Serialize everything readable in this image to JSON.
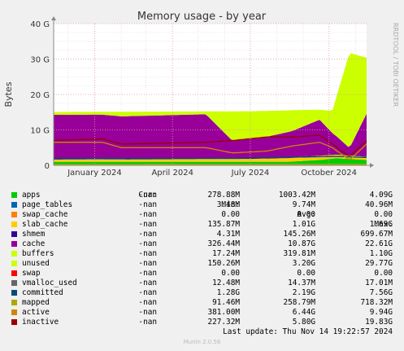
{
  "chart_data": {
    "type": "area",
    "title": "Memory usage - by year",
    "ylabel": "Bytes",
    "side_label": "RRDTOOL / TOBI OETIKER",
    "ylim": [
      0,
      40
    ],
    "y_unit": "G",
    "yticks": [
      0,
      10,
      20,
      30,
      40
    ],
    "ytick_labels": [
      "0",
      "10 G",
      "20 G",
      "30 G",
      "40 G"
    ],
    "xlim": [
      "2023-11-14",
      "2024-11-14"
    ],
    "xticks": [
      "2024-01-01",
      "2024-04-01",
      "2024-07-01",
      "2024-10-01"
    ],
    "xtick_labels": [
      "January 2024",
      "April 2024",
      "July 2024",
      "October 2024"
    ],
    "stacked_series": [
      {
        "name": "apps",
        "color": "#00cc00",
        "x": [
          "2023-11-14",
          "2024-01-15",
          "2024-06-10",
          "2024-08-15",
          "2024-09-20",
          "2024-10-10",
          "2024-11-14"
        ],
        "values": [
          1.0,
          1.0,
          1.0,
          1.0,
          1.5,
          2.0,
          1.5
        ]
      },
      {
        "name": "page_tables",
        "color": "#0066b3",
        "x": [
          "2023-11-14",
          "2024-11-14"
        ],
        "values": [
          0.01,
          0.02
        ]
      },
      {
        "name": "swap_cache",
        "color": "#ff8000",
        "x": [
          "2023-11-14",
          "2024-11-14"
        ],
        "values": [
          0,
          0
        ]
      },
      {
        "name": "slab_cache",
        "color": "#ffcc00",
        "x": [
          "2023-11-14",
          "2024-07-01",
          "2024-09-20",
          "2024-10-10",
          "2024-11-14"
        ],
        "values": [
          0.6,
          0.8,
          1.2,
          1.0,
          0.9
        ]
      },
      {
        "name": "shmem",
        "color": "#330099",
        "x": [
          "2023-11-14",
          "2024-11-14"
        ],
        "values": [
          0.14,
          0.15
        ]
      },
      {
        "name": "cache",
        "color": "#990099",
        "x": [
          "2023-11-14",
          "2024-01-10",
          "2024-02-01",
          "2024-05-10",
          "2024-06-10",
          "2024-07-20",
          "2024-08-20",
          "2024-09-20",
          "2024-10-05",
          "2024-10-25",
          "2024-11-14"
        ],
        "values": [
          12.5,
          12.5,
          12.0,
          12.5,
          5.0,
          6.0,
          7.5,
          10.0,
          6.0,
          2.0,
          12.0
        ]
      },
      {
        "name": "buffers",
        "color": "#ccff00",
        "x": [
          "2023-11-14",
          "2024-11-14"
        ],
        "values": [
          0.3,
          0.3
        ]
      },
      {
        "name": "unused",
        "color": "#ccff00",
        "x": [
          "2023-11-14",
          "2024-01-10",
          "2024-02-01",
          "2024-05-10",
          "2024-06-10",
          "2024-07-20",
          "2024-08-20",
          "2024-09-20",
          "2024-10-05",
          "2024-10-25",
          "2024-11-14"
        ],
        "values": [
          0.5,
          0.5,
          1.0,
          0.5,
          8.0,
          7.0,
          5.5,
          2.5,
          6.0,
          26.5,
          15.5
        ]
      },
      {
        "name": "swap",
        "color": "#ff0000",
        "x": [
          "2023-11-14",
          "2024-11-14"
        ],
        "values": [
          0,
          0
        ]
      }
    ],
    "line_series": [
      {
        "name": "vmalloc_used",
        "color": "#666666",
        "x": [
          "2023-11-14",
          "2024-11-14"
        ],
        "values": [
          0.014,
          0.015
        ]
      },
      {
        "name": "committed",
        "color": "#014d7a",
        "x": [
          "2023-11-14",
          "2024-06-10",
          "2024-10-10",
          "2024-11-14"
        ],
        "values": [
          2.0,
          2.0,
          2.5,
          2.2
        ]
      },
      {
        "name": "mapped",
        "color": "#aaaa00",
        "x": [
          "2023-11-14",
          "2024-11-14"
        ],
        "values": [
          0.25,
          0.3
        ]
      },
      {
        "name": "active",
        "color": "#cc8800",
        "x": [
          "2023-11-14",
          "2024-01-10",
          "2024-02-01",
          "2024-05-10",
          "2024-06-10",
          "2024-07-20",
          "2024-08-20",
          "2024-09-20",
          "2024-10-05",
          "2024-10-25",
          "2024-11-14"
        ],
        "values": [
          6.5,
          6.5,
          5.0,
          5.0,
          3.5,
          4.0,
          5.5,
          6.5,
          5.0,
          1.5,
          6.0
        ]
      },
      {
        "name": "inactive",
        "color": "#990000",
        "x": [
          "2023-11-14",
          "2024-01-10",
          "2024-02-01",
          "2024-05-10",
          "2024-06-10",
          "2024-07-20",
          "2024-08-20",
          "2024-09-20",
          "2024-10-05",
          "2024-10-25",
          "2024-11-14"
        ],
        "values": [
          7.0,
          7.5,
          6.0,
          6.5,
          7.0,
          8.0,
          8.0,
          8.5,
          6.0,
          2.5,
          7.0
        ]
      }
    ]
  },
  "legend": {
    "headers": {
      "cur": "Cur:",
      "min": "Min:",
      "avg": "Avg:",
      "max": "Max:"
    },
    "rows": [
      {
        "name": "apps",
        "color": "#00cc00",
        "cur": "-nan",
        "min": "278.88M",
        "avg": "1003.42M",
        "max": "4.09G"
      },
      {
        "name": "page_tables",
        "color": "#0066b3",
        "cur": "-nan",
        "min": "3.48M",
        "avg": "9.74M",
        "max": "40.96M"
      },
      {
        "name": "swap_cache",
        "color": "#ff8000",
        "cur": "-nan",
        "min": "0.00",
        "avg": "0.00",
        "max": "0.00"
      },
      {
        "name": "slab_cache",
        "color": "#ffcc00",
        "cur": "-nan",
        "min": "135.87M",
        "avg": "1.01G",
        "max": "1.69G"
      },
      {
        "name": "shmem",
        "color": "#330099",
        "cur": "-nan",
        "min": "4.31M",
        "avg": "145.26M",
        "max": "699.67M"
      },
      {
        "name": "cache",
        "color": "#990099",
        "cur": "-nan",
        "min": "326.44M",
        "avg": "10.87G",
        "max": "22.61G"
      },
      {
        "name": "buffers",
        "color": "#ccff00",
        "cur": "-nan",
        "min": "17.24M",
        "avg": "319.81M",
        "max": "1.10G"
      },
      {
        "name": "unused",
        "color": "#ccff00",
        "cur": "-nan",
        "min": "150.26M",
        "avg": "3.20G",
        "max": "29.77G"
      },
      {
        "name": "swap",
        "color": "#ff0000",
        "cur": "-nan",
        "min": "0.00",
        "avg": "0.00",
        "max": "0.00"
      },
      {
        "name": "vmalloc_used",
        "color": "#666666",
        "cur": "-nan",
        "min": "12.48M",
        "avg": "14.37M",
        "max": "17.01M"
      },
      {
        "name": "committed",
        "color": "#014d7a",
        "cur": "-nan",
        "min": "1.28G",
        "avg": "2.19G",
        "max": "7.56G"
      },
      {
        "name": "mapped",
        "color": "#aaaa00",
        "cur": "-nan",
        "min": "91.46M",
        "avg": "258.79M",
        "max": "718.32M"
      },
      {
        "name": "active",
        "color": "#cc8800",
        "cur": "-nan",
        "min": "381.00M",
        "avg": "6.44G",
        "max": "9.94G"
      },
      {
        "name": "inactive",
        "color": "#990000",
        "cur": "-nan",
        "min": "227.32M",
        "avg": "5.80G",
        "max": "19.83G"
      }
    ]
  },
  "footer": {
    "last_update": "Last update: Thu Nov 14 19:22:57 2024",
    "version": "Munin 2.0.56"
  }
}
